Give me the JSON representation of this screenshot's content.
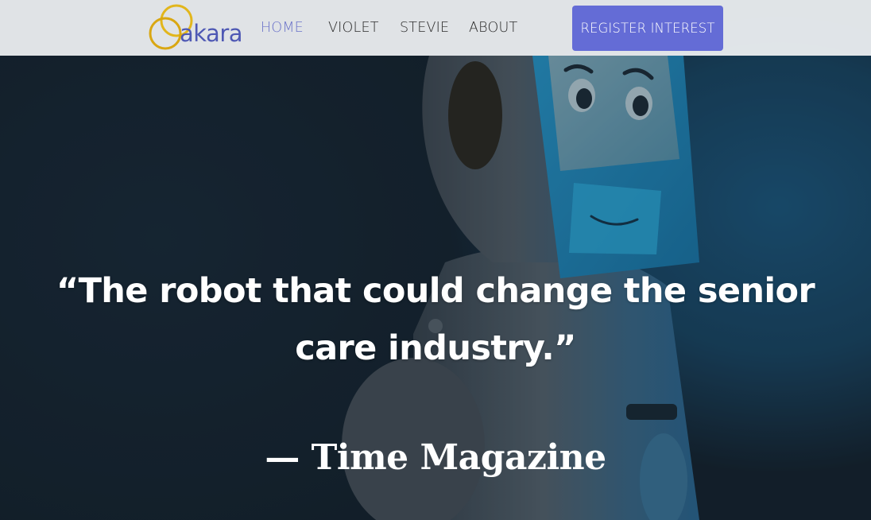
{
  "brand": {
    "logo_text": "akara"
  },
  "nav": {
    "links": [
      {
        "label": "HOME",
        "active": true
      },
      {
        "label": "VIOLET",
        "active": false
      },
      {
        "label": "STEVIE",
        "active": false
      },
      {
        "label": "ABOUT",
        "active": false
      }
    ],
    "cta_label": "REGISTER INTEREST"
  },
  "hero": {
    "quote": "“The robot that could change the senior care industry.”",
    "attribution": "— Time Magazine"
  },
  "colors": {
    "accent": "#646cd6",
    "nav_active": "#6a72c9",
    "logo_text": "#4e58b4",
    "logo_ring": "#e2b61c",
    "navbar_bg": "#f0f2f4",
    "robot_screen": "#2f9fd0"
  }
}
